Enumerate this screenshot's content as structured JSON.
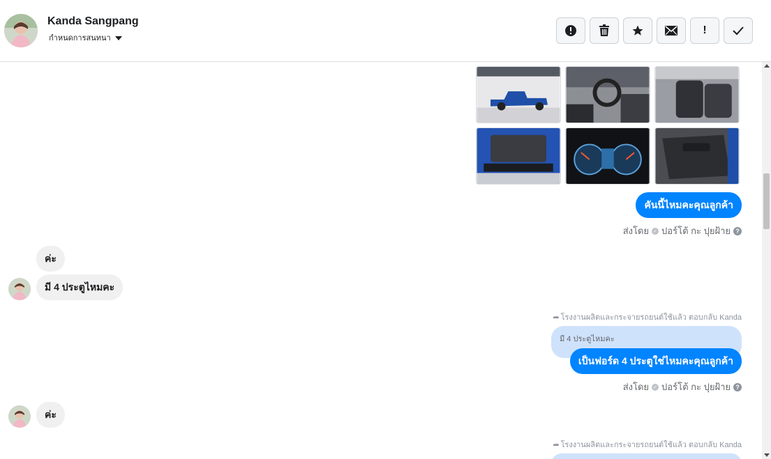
{
  "header": {
    "contact_name": "Kanda Sangpang",
    "assign_label": "กำหนดการสนทนา",
    "toolbar": [
      {
        "name": "spam-button",
        "icon": "alert-circle-icon",
        "glyph": "!"
      },
      {
        "name": "delete-button",
        "icon": "trash-icon",
        "glyph": ""
      },
      {
        "name": "star-button",
        "icon": "star-icon",
        "glyph": "★"
      },
      {
        "name": "mark-unread-button",
        "icon": "envelope-icon",
        "glyph": "✉"
      },
      {
        "name": "follow-up-button",
        "icon": "exclamation-icon",
        "glyph": "!"
      },
      {
        "name": "mark-done-button",
        "icon": "check-icon",
        "glyph": "✓"
      }
    ]
  },
  "messages": {
    "out_1": "คันนี้ไหมคะคุณลูกค้า",
    "sent_by_label": "ส่งโดย",
    "sent_by_name": "ปอร์โต้ กะ ปุยฝ้าย",
    "in_1": "ค่ะ",
    "in_2": "มี 4 ประตูไหมคะ",
    "reply_note": "โรงงานผลิตและกระจายรถยนต์ใช้แล้ว ตอบกลับ Kanda",
    "quote_text": "มี 4 ประตูไหมคะ",
    "out_2": "เป็นฟอร์ด 4 ประตูใช่ไหมคะคุณลูกค้า",
    "in_3": "ค่ะ",
    "reply_note_2": "โรงงานผลิตและกระจายรถยนต์ใช้แล้ว ตอบกลับ Kanda"
  },
  "colors": {
    "outgoing_bubble": "#0084ff",
    "incoming_bubble": "#f1f0f0",
    "quote_bubble": "#cfe2fc"
  }
}
